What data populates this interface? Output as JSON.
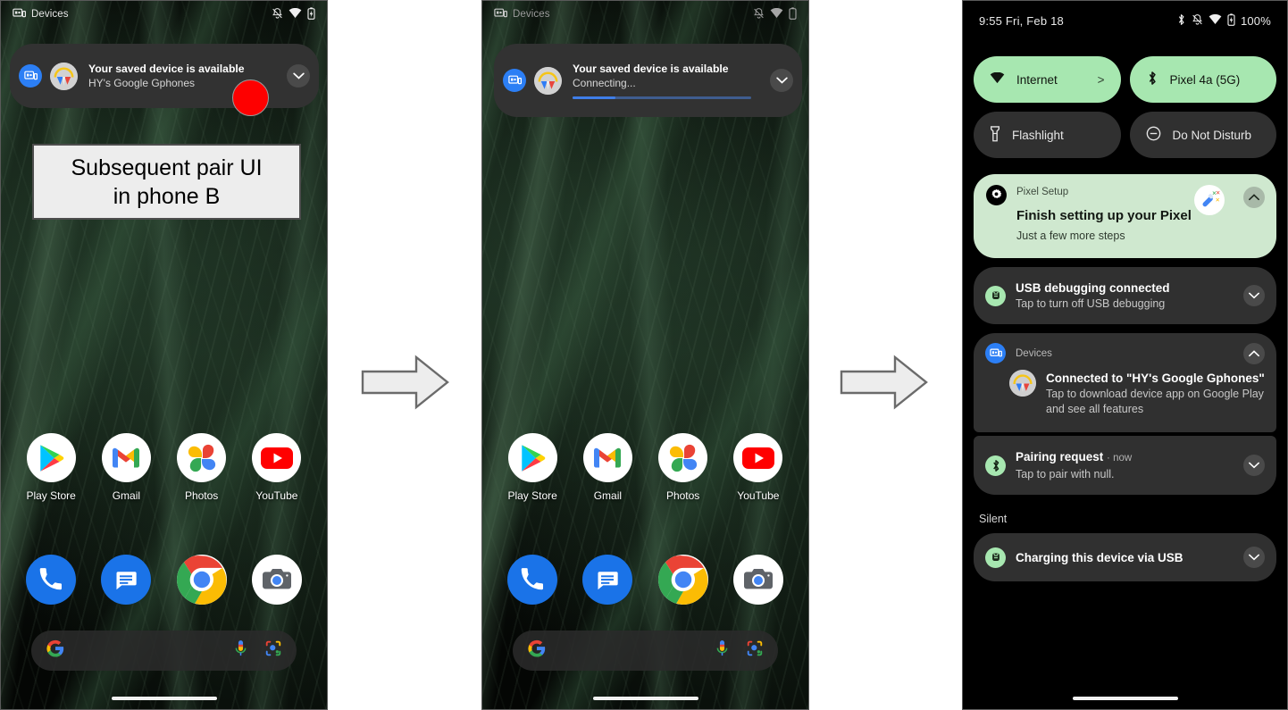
{
  "annotation": {
    "callout_text": "Subsequent pair UI\nin phone B",
    "callout_line1": "Subsequent pair UI",
    "callout_line2": "in phone B",
    "marker_color": "#fe0000",
    "arrow_fill": "#ededed",
    "arrow_stroke": "#6b6b6b"
  },
  "phone_a": {
    "statusbar": {
      "app_name": "Devices",
      "icons": [
        "devices-icon",
        "notifications-off-icon",
        "wifi-icon",
        "battery-icon"
      ]
    },
    "notification": {
      "app_icon": "devices-icon",
      "avatar": "earbuds-avatar",
      "title": "Your saved device is available",
      "subtitle": "HY's Google Gphones",
      "expand_icon": "chevron-down-icon"
    },
    "apps_row1": [
      {
        "label": "Play Store",
        "icon": "play-store-icon"
      },
      {
        "label": "Gmail",
        "icon": "gmail-icon"
      },
      {
        "label": "Photos",
        "icon": "google-photos-icon"
      },
      {
        "label": "YouTube",
        "icon": "youtube-icon"
      }
    ],
    "apps_row2": [
      {
        "label": "Phone",
        "icon": "phone-icon"
      },
      {
        "label": "Messages",
        "icon": "messages-icon"
      },
      {
        "label": "Chrome",
        "icon": "chrome-icon"
      },
      {
        "label": "Camera",
        "icon": "camera-icon"
      }
    ],
    "search": {
      "placeholder": "",
      "leading_icon": "google-g-icon",
      "trailing_icons": [
        "microphone-icon",
        "google-lens-icon"
      ]
    }
  },
  "phone_b": {
    "statusbar": {
      "app_name": "Devices",
      "icons": [
        "devices-icon",
        "notifications-off-icon",
        "wifi-icon",
        "battery-icon"
      ]
    },
    "notification": {
      "app_icon": "devices-icon",
      "avatar": "earbuds-avatar",
      "title": "Your saved device is available",
      "subtitle": "Connecting...",
      "progress_percent": 24,
      "progress_color": "#3f7ee8",
      "expand_icon": "chevron-down-icon"
    },
    "apps_row1": [
      {
        "label": "Play Store",
        "icon": "play-store-icon"
      },
      {
        "label": "Gmail",
        "icon": "gmail-icon"
      },
      {
        "label": "Photos",
        "icon": "google-photos-icon"
      },
      {
        "label": "YouTube",
        "icon": "youtube-icon"
      }
    ],
    "apps_row2": [
      {
        "label": "Phone",
        "icon": "phone-icon"
      },
      {
        "label": "Messages",
        "icon": "messages-icon"
      },
      {
        "label": "Chrome",
        "icon": "chrome-icon"
      },
      {
        "label": "Camera",
        "icon": "camera-icon"
      }
    ],
    "search": {
      "placeholder": "",
      "leading_icon": "google-g-icon",
      "trailing_icons": [
        "microphone-icon",
        "google-lens-icon"
      ]
    }
  },
  "phone_c": {
    "statusbar": {
      "clock": "9:55 Fri, Feb 18",
      "battery_percent": "100%",
      "icons": [
        "bluetooth-icon",
        "notifications-off-icon",
        "wifi-icon",
        "battery-icon"
      ]
    },
    "quick_settings": [
      {
        "label": "Internet",
        "icon": "wifi-icon",
        "state": "on",
        "chevron": ">"
      },
      {
        "label": "Pixel 4a (5G)",
        "icon": "bluetooth-icon",
        "state": "on",
        "chevron": ""
      },
      {
        "label": "Flashlight",
        "icon": "flashlight-icon",
        "state": "off",
        "chevron": ""
      },
      {
        "label": "Do Not Disturb",
        "icon": "do-not-disturb-icon",
        "state": "off",
        "chevron": ""
      }
    ],
    "notifications": [
      {
        "app": "Pixel Setup",
        "app_icon": "gear-icon",
        "title": "Finish setting up your Pixel",
        "subtitle": "Just a few more steps",
        "large_icon": "magic-wand-icon",
        "expand_icon": "chevron-up-icon",
        "theme": "green"
      },
      {
        "app": "",
        "app_icon": "android-usb-icon",
        "title": "USB debugging connected",
        "subtitle": "Tap to turn off USB debugging",
        "expand_icon": "chevron-down-icon",
        "theme": "dark"
      },
      {
        "app": "Devices",
        "app_icon": "devices-icon",
        "title": "Connected to \"HY's Google Gphones\"",
        "subtitle": "Tap to download device app on Google Play and see all features",
        "avatar": "earbuds-avatar",
        "expand_icon": "chevron-up-icon",
        "theme": "dark-grouped"
      },
      {
        "app": "",
        "app_icon": "bluetooth-icon",
        "title": "Pairing request",
        "when": "· now",
        "subtitle": "Tap to pair with null.",
        "expand_icon": "chevron-down-icon",
        "theme": "dark"
      }
    ],
    "silent_section": {
      "label": "Silent",
      "notifications": [
        {
          "app_icon": "android-usb-icon",
          "title": "Charging this device via USB",
          "expand_icon": "chevron-down-icon"
        }
      ]
    }
  }
}
